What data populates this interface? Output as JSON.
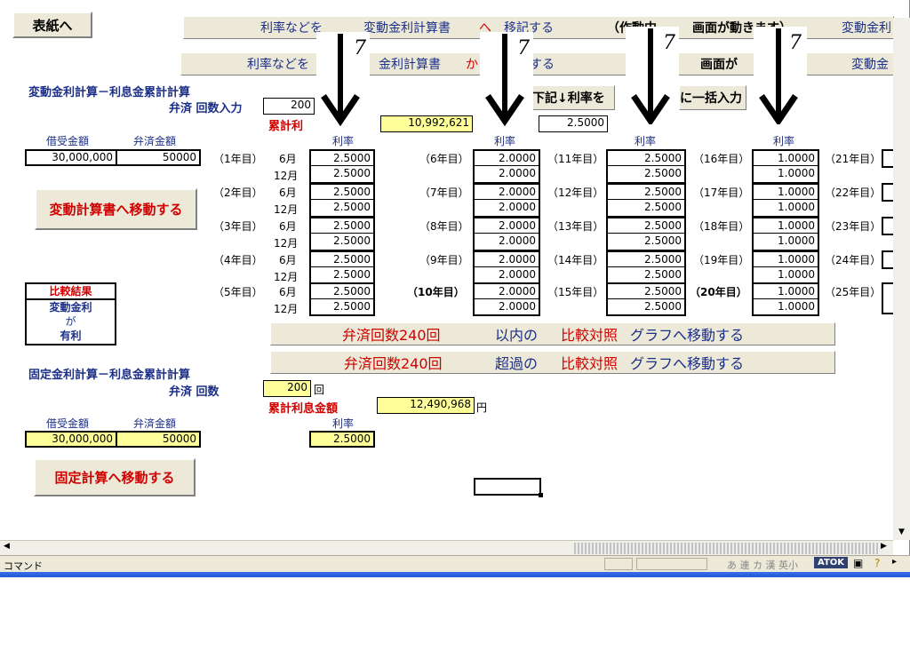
{
  "buttons": {
    "cover": "表紙へ",
    "move_variable": "変動計算書へ移動する",
    "move_fixed": "固定計算へ移動する"
  },
  "top_bar1": {
    "part1": "利率などを",
    "part2": "変動金利計算書",
    "part3": "へ",
    "part4": "移記する",
    "part5": "（作動中",
    "part6": "画面が動きます）",
    "part7": "変動金利"
  },
  "top_bar2": {
    "part1": "利率などを",
    "part2": "金利計算書",
    "part3": "か",
    "part4": "する",
    "part5": "画面が",
    "part6": "変動金"
  },
  "variable": {
    "title": "変動金利計算－利息金累計計算",
    "count_label": "弁済 回数入力",
    "count_value": "200",
    "cum_label": "累計利",
    "cum_value": "10,992,621",
    "bulk_label": "下記↓利率を",
    "bulk_label2": "に一括入力",
    "bulk_value": "2.5000",
    "loan_header": "借受金額",
    "pay_header": "弁済金額",
    "loan_value": "30,000,000",
    "pay_value": "50000",
    "rate_header": "利率",
    "month_jun": "6月",
    "month_dec": "12月",
    "years": [
      "（1年目）",
      "（2年目）",
      "（3年目）",
      "（4年目）",
      "（5年目）",
      "（6年目）",
      "（7年目）",
      "（8年目）",
      "（9年目）",
      "（10年目）",
      "（11年目）",
      "（12年目）",
      "（13年目）",
      "（14年目）",
      "（15年目）",
      "（16年目）",
      "（17年目）",
      "（18年目）",
      "（19年目）",
      "（20年目）",
      "（21年目）",
      "（22年目）",
      "（23年目）",
      "（24年目）",
      "（25年目）"
    ],
    "rates_col1": [
      "2.5000",
      "2.5000",
      "2.5000",
      "2.5000",
      "2.5000",
      "2.5000",
      "2.5000",
      "2.5000",
      "2.5000",
      "2.5000"
    ],
    "rates_col2": [
      "2.0000",
      "2.0000",
      "2.0000",
      "2.0000",
      "2.0000",
      "2.0000",
      "2.0000",
      "2.0000",
      "2.0000",
      "2.0000"
    ],
    "rates_col3": [
      "2.5000",
      "2.5000",
      "2.5000",
      "2.5000",
      "2.5000",
      "2.5000",
      "2.5000",
      "2.5000",
      "2.5000",
      "2.5000"
    ],
    "rates_col4": [
      "1.0000",
      "1.0000",
      "1.0000",
      "1.0000",
      "1.0000",
      "1.0000",
      "1.0000",
      "1.0000",
      "1.0000",
      "1.0000"
    ]
  },
  "comparison": {
    "title": "比較結果",
    "line1": "変動金利",
    "line2": "が",
    "line3": "有利"
  },
  "graph_buttons": [
    {
      "a": "弁済回数240回",
      "b": "以内の",
      "c": "比較対照",
      "d": "グラフへ移動する"
    },
    {
      "a": "弁済回数240回",
      "b": "超過の",
      "c": "比較対照",
      "d": "グラフへ移動する"
    }
  ],
  "fixed": {
    "title": "固定金利計算－利息金累計計算",
    "count_label": "弁済 回数",
    "count_value": "200",
    "count_unit": "回",
    "cum_label": "累計利息金額",
    "cum_value": "12,490,968",
    "cum_unit": "円",
    "loan_header": "借受金額",
    "pay_header": "弁済金額",
    "rate_header": "利率",
    "loan_value": "30,000,000",
    "pay_value": "50000",
    "rate_value": "2.5000"
  },
  "arrow_label": "7",
  "status": {
    "mode": "コマンド",
    "ime": "あ 連 カ 漢 英小",
    "atok": "ATOK"
  },
  "colors": {
    "accent_navy": "#1c2f88",
    "accent_red": "#d00000",
    "input_yellow": "#ffff99",
    "button_face": "#ece9d8"
  }
}
